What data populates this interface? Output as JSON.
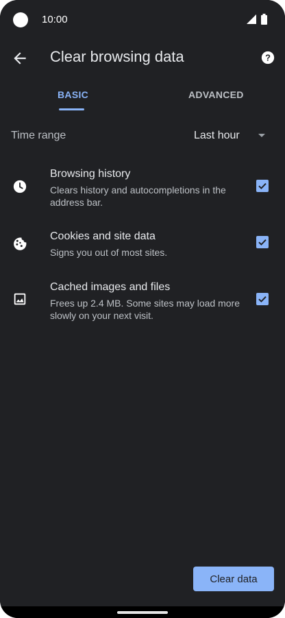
{
  "status_bar": {
    "time": "10:00"
  },
  "toolbar": {
    "title": "Clear browsing data",
    "back_icon": "arrow-back-icon",
    "help_icon": "help-icon"
  },
  "tabs": [
    {
      "label": "BASIC",
      "selected": true
    },
    {
      "label": "ADVANCED",
      "selected": false
    }
  ],
  "time_range": {
    "label": "Time range",
    "value": "Last hour"
  },
  "options": [
    {
      "icon": "clock-icon",
      "title": "Browsing history",
      "description": "Clears history and autocompletions in the address bar.",
      "checked": true
    },
    {
      "icon": "cookie-icon",
      "title": "Cookies and site data",
      "description": "Signs you out of most sites.",
      "checked": true
    },
    {
      "icon": "image-icon",
      "title": "Cached images and files",
      "description": "Frees up 2.4 MB. Some sites may load more slowly on your next visit.",
      "checked": true
    }
  ],
  "clear_button": {
    "label": "Clear data"
  },
  "colors": {
    "background": "#202124",
    "accent": "#8ab4f8",
    "text": "#e8eaed",
    "secondary_text": "#bdc1c6"
  }
}
